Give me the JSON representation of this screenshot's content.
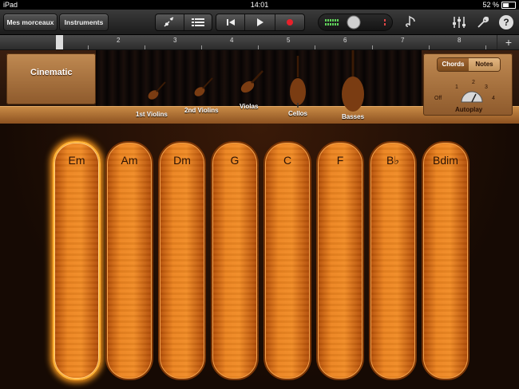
{
  "status": {
    "device": "iPad",
    "time": "14:01",
    "battery": "52 %"
  },
  "toolbar": {
    "my_songs": "Mes morceaux",
    "instruments": "Instruments"
  },
  "ruler": {
    "marks": [
      "1",
      "2",
      "3",
      "4",
      "5",
      "6",
      "7",
      "8"
    ],
    "add": "+"
  },
  "stage": {
    "instrument_name": "Cinematic",
    "sections": [
      "1st Violins",
      "2nd Violins",
      "Violas",
      "Cellos",
      "Basses"
    ],
    "mode_chords": "Chords",
    "mode_notes": "Notes",
    "autoplay_label": "Autoplay",
    "autoplay_off": "Off",
    "autoplay_positions": [
      "1",
      "2",
      "3",
      "4"
    ]
  },
  "chords": [
    "Em",
    "Am",
    "Dm",
    "G",
    "C",
    "F",
    "B♭",
    "Bdim"
  ],
  "selected_chord": 0
}
